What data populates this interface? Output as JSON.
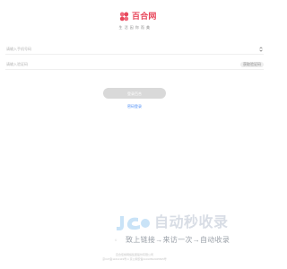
{
  "brand": {
    "name": "百合网",
    "slogan": "生 活 因 你 而 美",
    "accent": "#e8485c",
    "icon": "lily-flower-icon"
  },
  "login": {
    "username_placeholder": "请输入手机号码",
    "password_placeholder": "请输入验证码",
    "get_code_label": "获取验证码",
    "submit_label": "登录百合",
    "alt_login_label": "密码登录"
  },
  "watermark": {
    "title": "自动秒收录",
    "subtitle": "致上链接→来访一次→自动收录"
  },
  "footer": {
    "mark": "©",
    "line1": "百合佳缘网络集团股份有限公司",
    "line2": "京ICP备11012119号-1 京公网安备11010502045505号"
  }
}
